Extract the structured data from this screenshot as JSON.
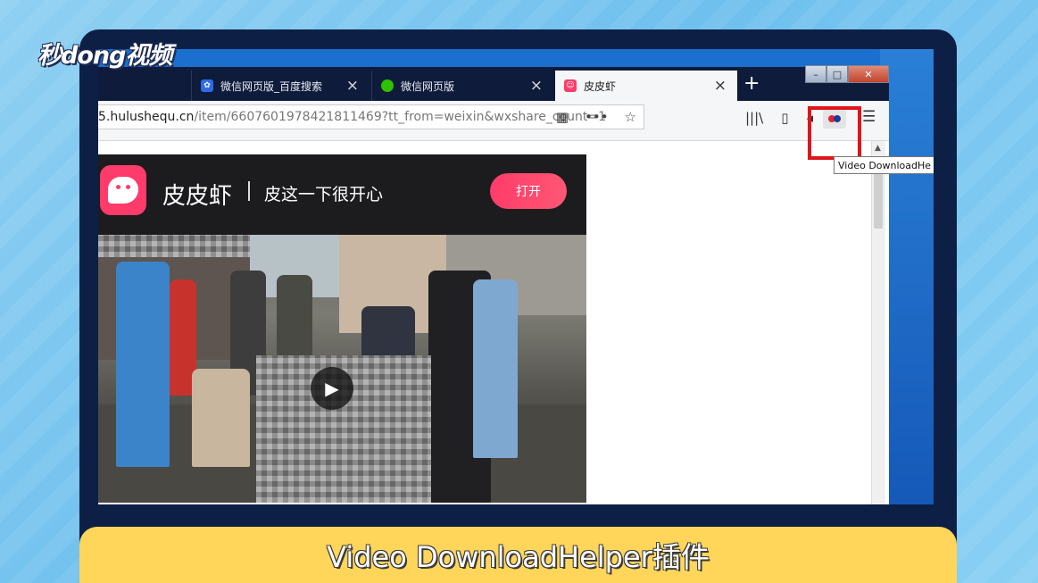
{
  "watermark": "秒dong视频",
  "browser": {
    "tabs": [
      {
        "label": "",
        "active": false
      },
      {
        "label": "微信网页版_百度搜索",
        "close": "×",
        "icon": "baidu-paw-icon"
      },
      {
        "label": "微信网页版",
        "close": "×",
        "icon": "wechat-icon"
      },
      {
        "label": "皮皮虾",
        "close": "×",
        "icon": "pipixia-icon",
        "active": true
      }
    ],
    "new_tab": "+",
    "window_controls": {
      "minimize": "–",
      "maximize": "□",
      "close": "✕"
    },
    "url": {
      "domain": "5.hulushequ.cn",
      "path": "/item/6607601978421811469?tt_from=weixin&wxshare_count=1"
    },
    "url_icons": {
      "qr": "▦",
      "more": "•••",
      "bookmark": "☆"
    },
    "toolbar_icons": {
      "library": "|||\\",
      "sidebar": "▯",
      "back": "◂",
      "menu": "☰"
    },
    "extension_tooltip": "Video DownloadHe",
    "highlight_color": "#e0151b"
  },
  "page": {
    "app_name": "皮皮虾",
    "separator": "|",
    "slogan": "皮这一下很开心",
    "open_button": "打开",
    "play_icon": "▶",
    "scroll_up": "▲"
  },
  "caption": "Video DownloadHelper插件"
}
